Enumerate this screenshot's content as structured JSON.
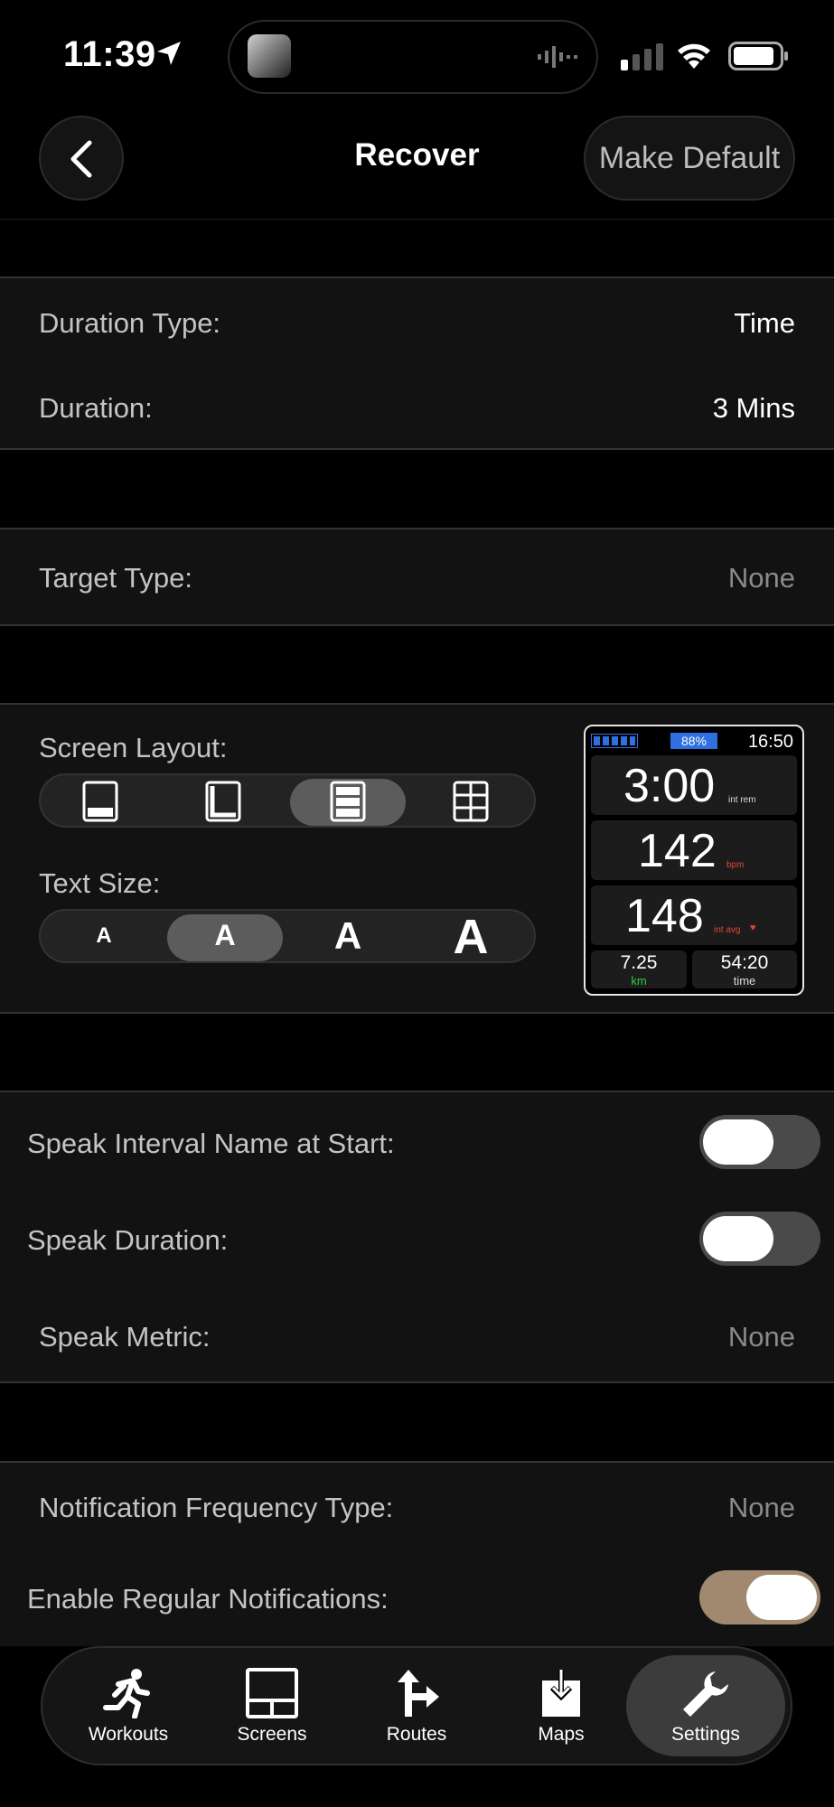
{
  "status": {
    "time": "11:39"
  },
  "header": {
    "title": "Recover",
    "make_default": "Make Default"
  },
  "duration_card": {
    "duration_type_label": "Duration Type:",
    "duration_type_value": "Time",
    "duration_label": "Duration:",
    "duration_value": "3 Mins"
  },
  "target_card": {
    "label": "Target Type:",
    "value": "None"
  },
  "screen_card": {
    "layout_label": "Screen Layout:",
    "layout_selected_index": 2,
    "text_size_label": "Text Size:",
    "text_size_option": "A",
    "text_size_selected_index": 1
  },
  "watch_preview": {
    "battery_percent": "88%",
    "clock": "16:50",
    "field1_value": "3:00",
    "field1_unit": "int rem",
    "field2_value": "142",
    "field2_unit": "bpm",
    "field3_value": "148",
    "field3_unit": "int avg",
    "field4_value": "7.25",
    "field4_unit": "km",
    "field5_value": "54:20",
    "field5_unit": "time"
  },
  "speak_card": {
    "speak_name_label": "Speak Interval Name at Start:",
    "speak_name_on": false,
    "speak_duration_label": "Speak Duration:",
    "speak_duration_on": false,
    "speak_metric_label": "Speak Metric:",
    "speak_metric_value": "None"
  },
  "notification_card": {
    "freq_label": "Notification Frequency Type:",
    "freq_value": "None",
    "enable_label": "Enable Regular Notifications:",
    "enable_on": true
  },
  "tabs": [
    {
      "label": "Workouts",
      "icon": "runner-icon"
    },
    {
      "label": "Screens",
      "icon": "screens-icon"
    },
    {
      "label": "Routes",
      "icon": "routes-icon"
    },
    {
      "label": "Maps",
      "icon": "maps-icon"
    },
    {
      "label": "Settings",
      "icon": "wrench-icon",
      "selected": true
    }
  ],
  "colors": {
    "accent_toggle": "#a0896f",
    "battery_blue": "#2f6fe0",
    "green": "#2ecc40",
    "red": "#e0443a"
  }
}
